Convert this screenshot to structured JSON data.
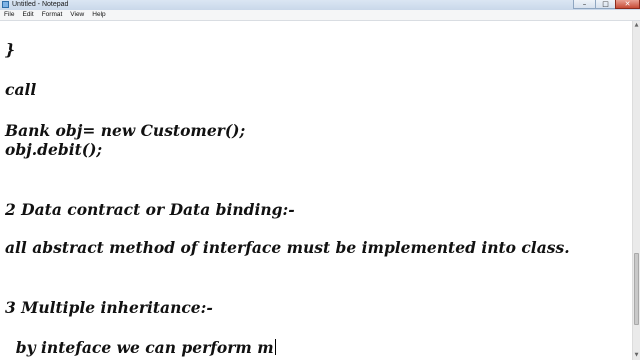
{
  "window": {
    "title": "Untitled - Notepad",
    "controls": {
      "minimize": "–",
      "maximize": "□",
      "close": "✕"
    }
  },
  "menu": [
    "File",
    "Edit",
    "Format",
    "View",
    "Help"
  ],
  "editor": {
    "lines": [
      "}",
      "call",
      "Bank obj= new Customer();",
      "obj.debit();",
      "2 Data contract or Data binding:-",
      "all abstract method of interface must be implemented into class.",
      "3 Multiple inheritance:-",
      "  by inteface we can perform m"
    ]
  },
  "scrollbar": {
    "up_arrow": "▲",
    "down_arrow": "▼"
  }
}
